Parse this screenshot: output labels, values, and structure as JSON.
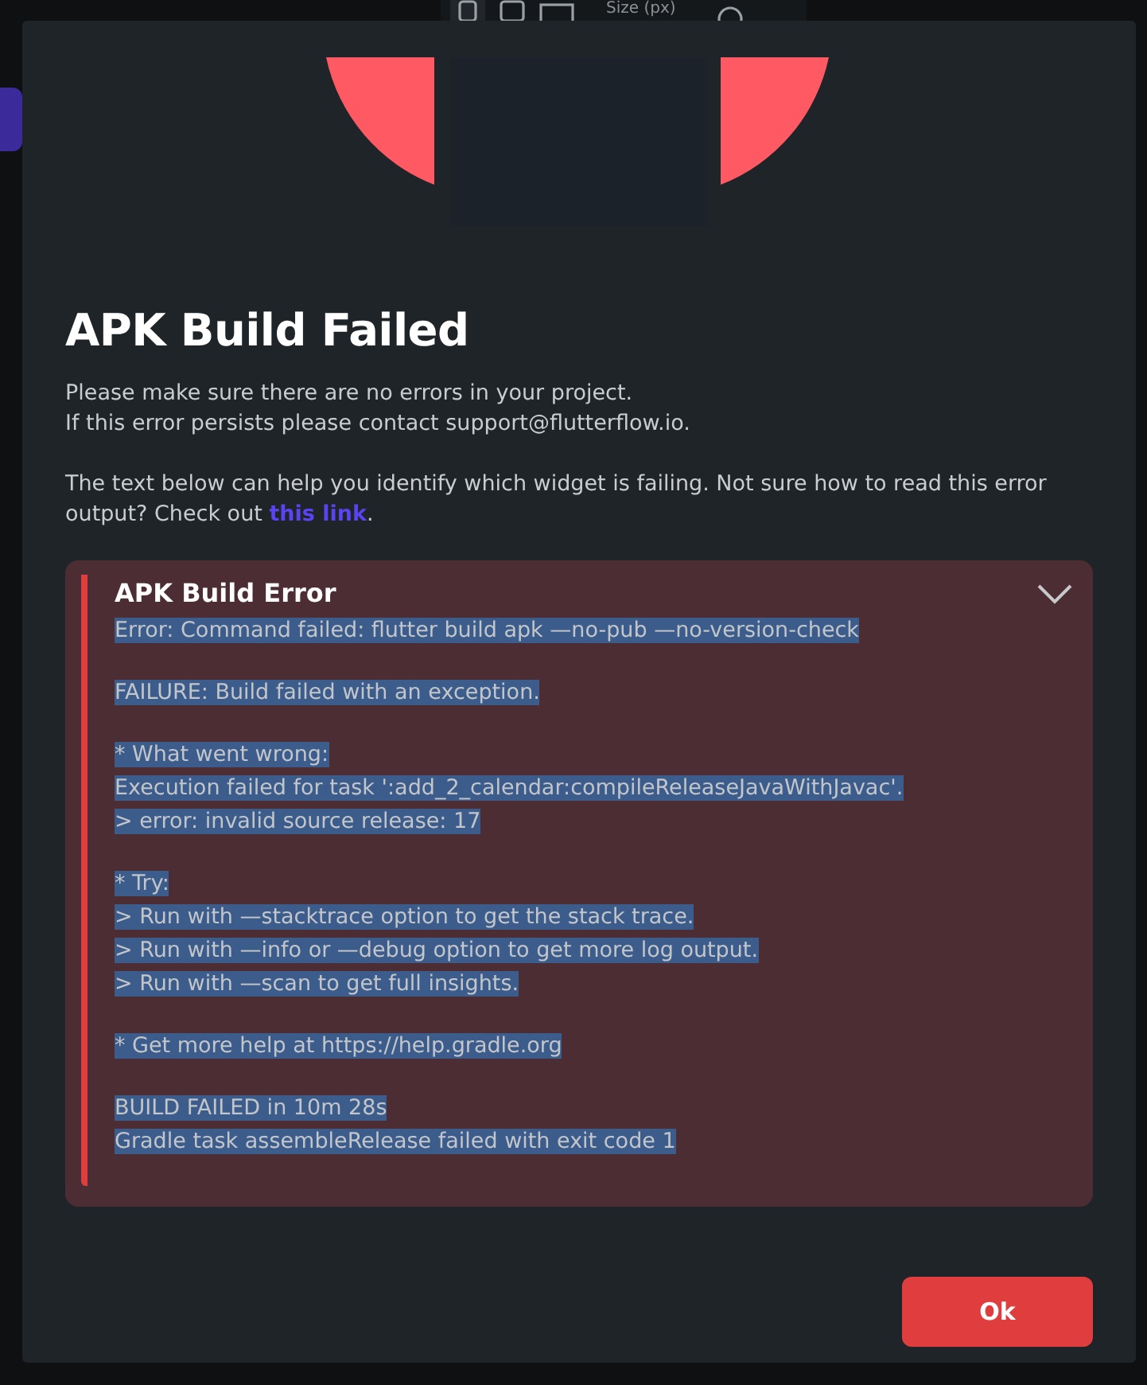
{
  "toolbar": {
    "size_label": "Size (px)"
  },
  "dialog": {
    "title": "APK Build Failed",
    "message_lines": [
      "Please make sure there are no errors in your project.",
      "If this error persists please contact support@flutterflow.io."
    ],
    "help_text": "The text below can help you identify which widget is failing. Not sure how to read this error output? Check out ",
    "help_link": "this link",
    "help_end": ".",
    "error_panel": {
      "title": "APK Build Error",
      "expanded": true,
      "text_selected": true,
      "blocks": [
        [
          "Error: Command failed: flutter build apk —no-pub —no-version-check"
        ],
        [
          "FAILURE: Build failed with an exception."
        ],
        [
          "* What went wrong:",
          "Execution failed for task ':add_2_calendar:compileReleaseJavaWithJavac'.",
          "> error: invalid source release: 17"
        ],
        [
          "* Try:",
          "> Run with —stacktrace option to get the stack trace.",
          "> Run with —info or —debug option to get more log output.",
          "> Run with —scan to get full insights."
        ],
        [
          "* Get more help at https://help.gradle.org"
        ],
        [
          "BUILD FAILED in 10m 28s",
          "Gradle task assembleRelease failed with exit code 1"
        ]
      ]
    },
    "buttons": [
      "Ok"
    ]
  }
}
